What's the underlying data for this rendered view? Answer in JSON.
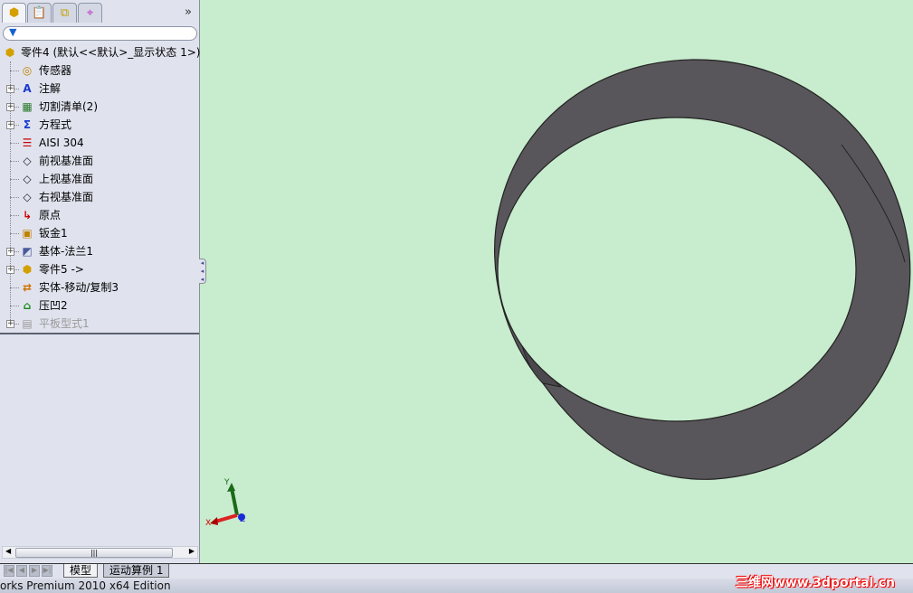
{
  "panel": {
    "tabs": [
      "feature-manager-icon",
      "property-manager-icon",
      "configuration-manager-icon",
      "dimxpert-manager-icon"
    ],
    "more_label": "»",
    "filter_icon": "filter-icon",
    "tree": [
      {
        "label": "零件4  (默认<<默认>_显示状态 1>)",
        "icon": "part-icon",
        "expand": false,
        "root": true
      },
      {
        "label": "传感器",
        "icon": "sensor-folder-icon",
        "expand": false
      },
      {
        "label": "注解",
        "icon": "annotations-folder-icon",
        "expand": true
      },
      {
        "label": "切割清单(2)",
        "icon": "cut-list-icon",
        "expand": true
      },
      {
        "label": "方程式",
        "icon": "equations-folder-icon",
        "expand": true
      },
      {
        "label": "AISI 304",
        "icon": "material-icon",
        "expand": false
      },
      {
        "label": "前视基准面",
        "icon": "plane-icon",
        "expand": false
      },
      {
        "label": "上视基准面",
        "icon": "plane-icon",
        "expand": false
      },
      {
        "label": "右视基准面",
        "icon": "plane-icon",
        "expand": false
      },
      {
        "label": "原点",
        "icon": "origin-icon",
        "expand": false
      },
      {
        "label": "钣金1",
        "icon": "sheet-metal-icon",
        "expand": false
      },
      {
        "label": "基体-法兰1",
        "icon": "base-flange-icon",
        "expand": true
      },
      {
        "label": "零件5 ->",
        "icon": "part-icon",
        "expand": true
      },
      {
        "label": "实体-移动/复制3",
        "icon": "move-copy-icon",
        "expand": false
      },
      {
        "label": "压凹2",
        "icon": "indent-icon",
        "expand": false
      },
      {
        "label": "平板型式1",
        "icon": "flat-pattern-icon",
        "expand": true,
        "suppressed": true
      }
    ]
  },
  "bottom_tabs": {
    "model": "模型",
    "motion": "运动算例 1"
  },
  "status_text": "orks Premium 2010 x64 Edition",
  "watermark": "三维网www.3dportal.cn",
  "triad": {
    "x": "X",
    "y": "Y",
    "z": "Z"
  },
  "colors": {
    "viewport": "#c8ecce",
    "part": "#58565a",
    "panel": "#e0e3ee"
  }
}
